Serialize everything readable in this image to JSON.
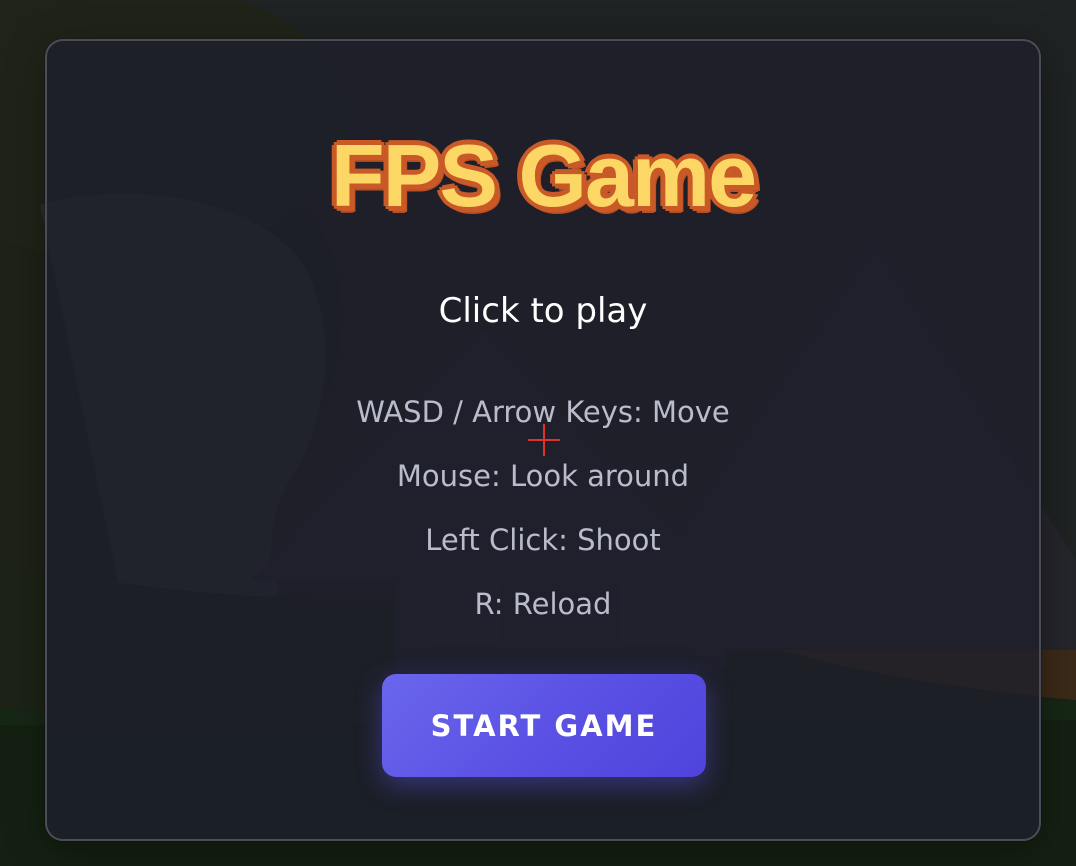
{
  "game": {
    "title": "FPS Game",
    "subtitle": "Click to play"
  },
  "controls": [
    "WASD / Arrow Keys: Move",
    "Mouse: Look around",
    "Left Click: Shoot",
    "R: Reload"
  ],
  "start_button": {
    "label": "START GAME"
  },
  "hud": {
    "crosshair_icon": "crosshair-icon"
  },
  "colors": {
    "title_fill": "#fcd765",
    "title_outline": "#c95a28",
    "button_accent": "#5a50e4",
    "crosshair": "#e0302b",
    "panel_border": "#4a4d57"
  }
}
